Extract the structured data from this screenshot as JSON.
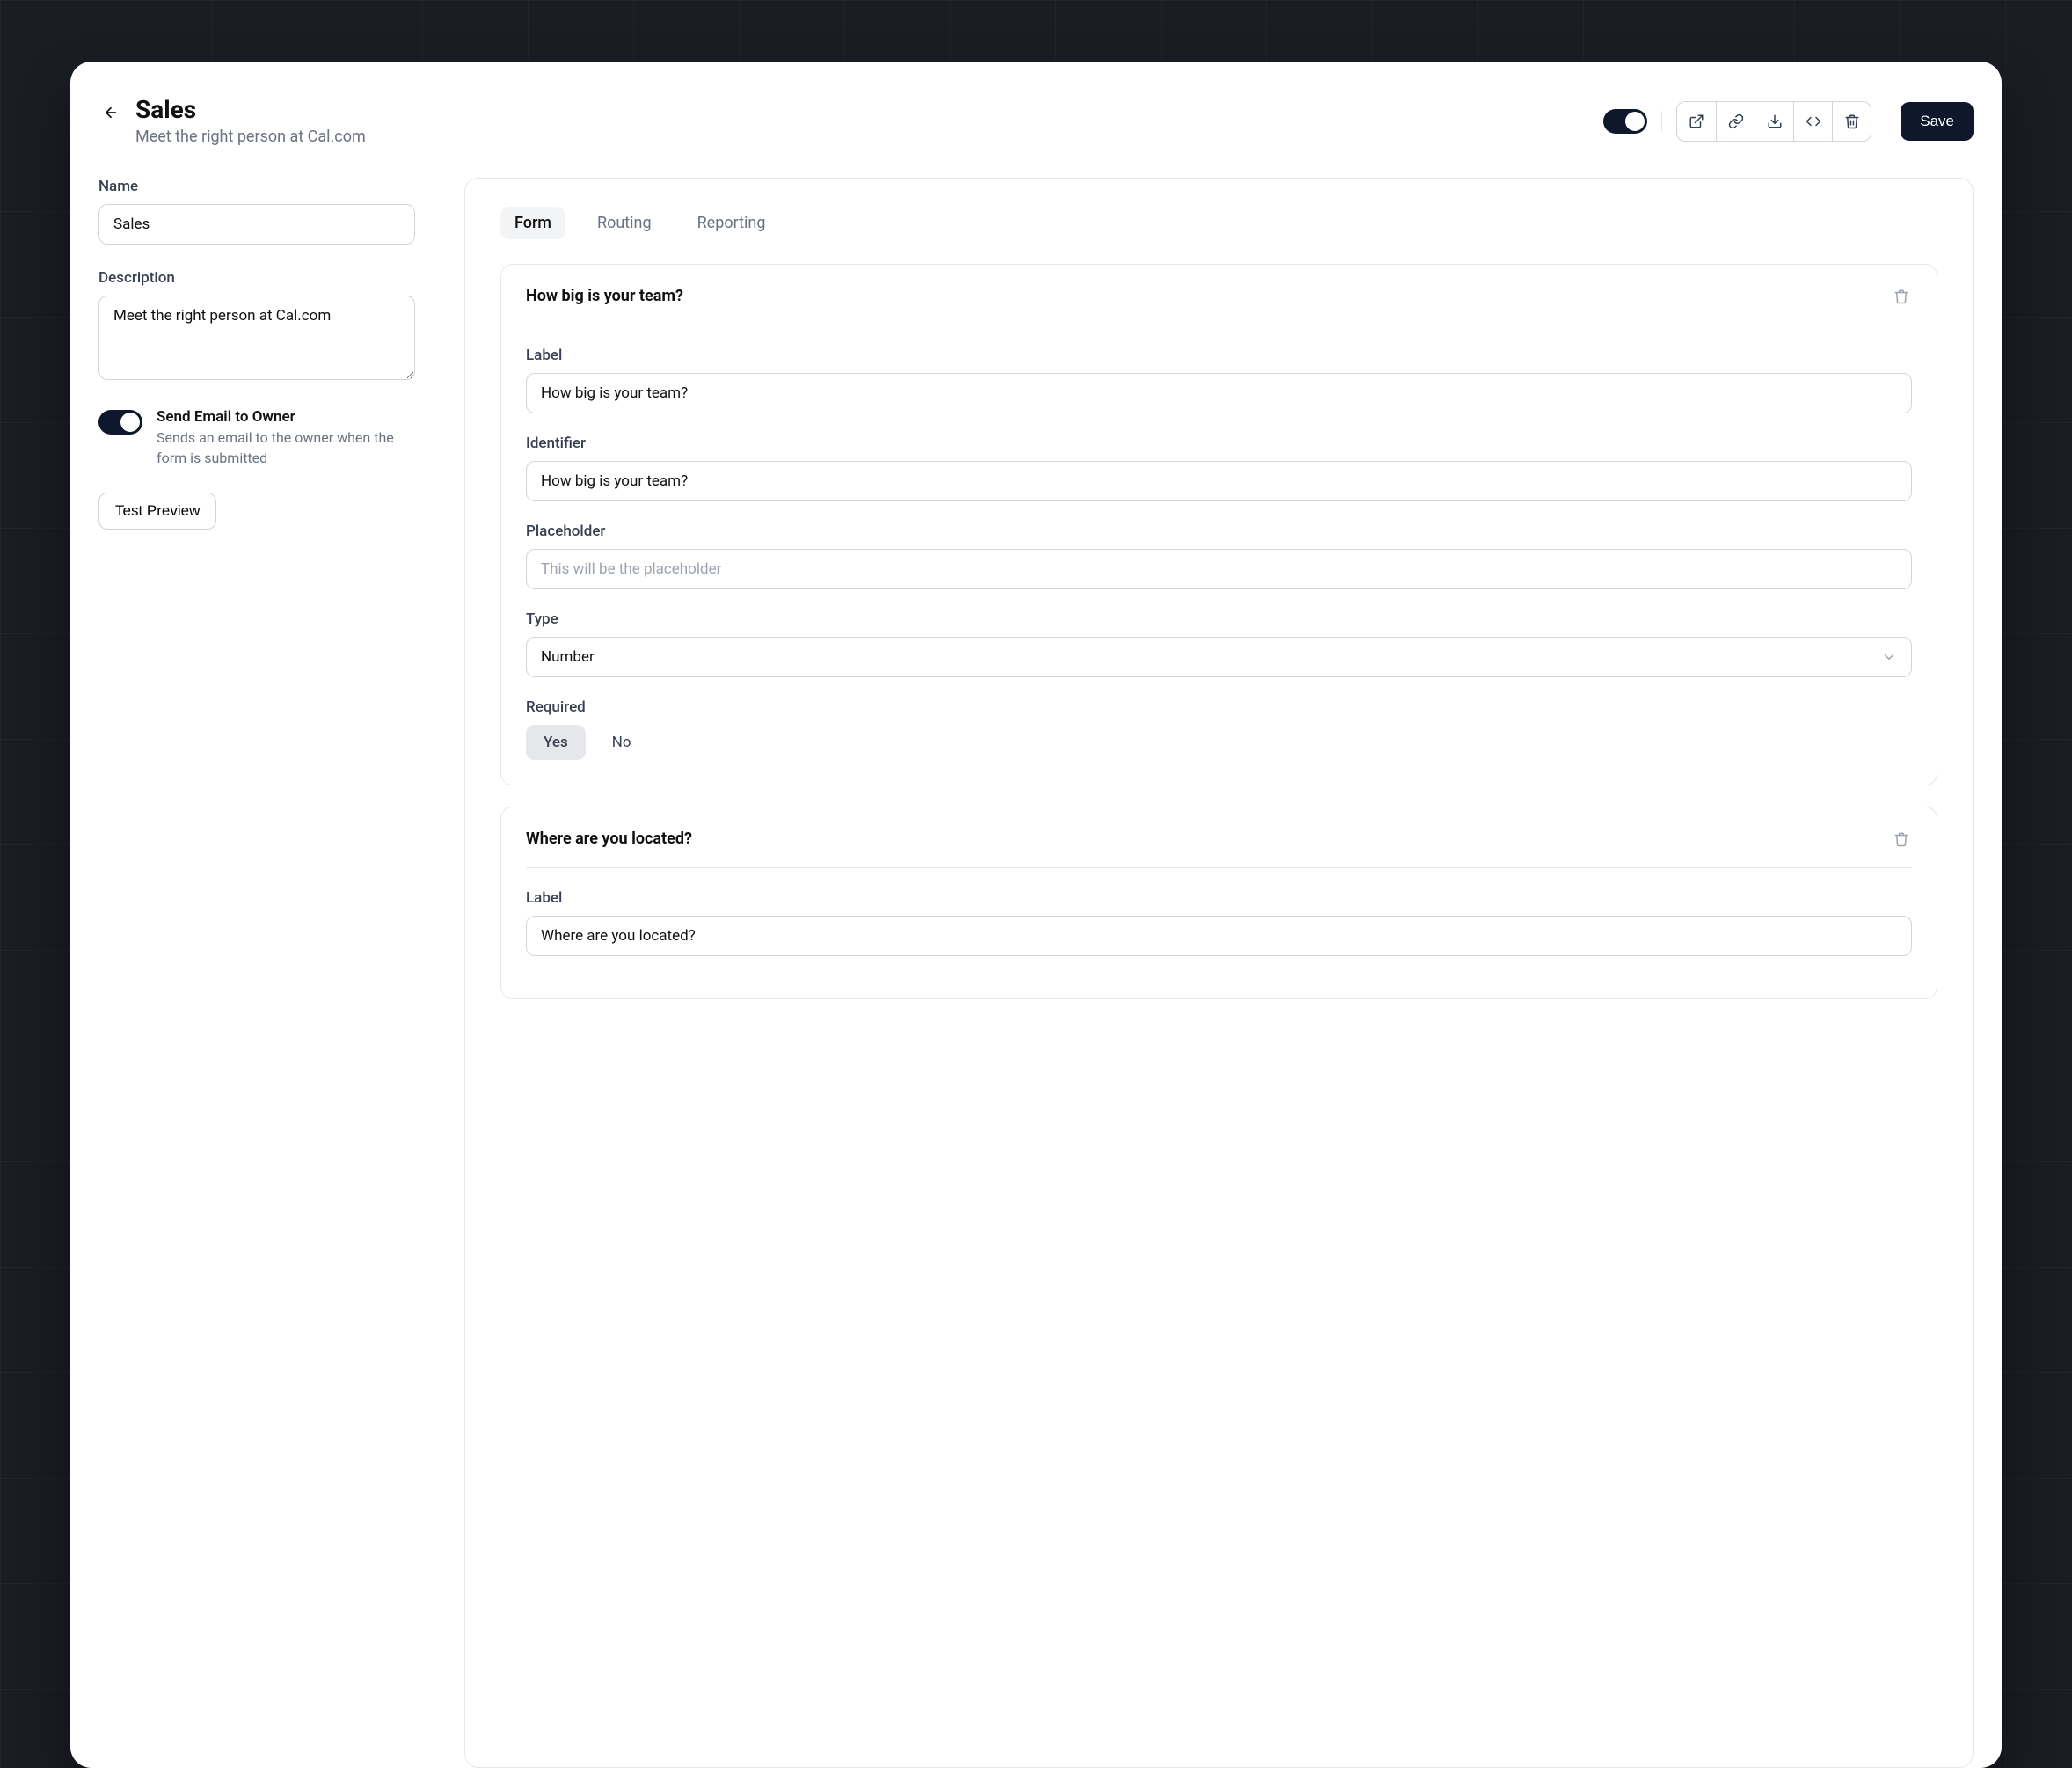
{
  "header": {
    "title": "Sales",
    "subtitle": "Meet the right person at Cal.com",
    "save_label": "Save"
  },
  "sidebar": {
    "name_label": "Name",
    "name_value": "Sales",
    "description_label": "Description",
    "description_value": "Meet the right person at Cal.com",
    "email_switch_title": "Send Email to Owner",
    "email_switch_desc": "Sends an email to the owner when the form is submitted",
    "test_preview_label": "Test Preview"
  },
  "tabs": [
    "Form",
    "Routing",
    "Reporting"
  ],
  "form_field_labels": {
    "label": "Label",
    "identifier": "Identifier",
    "placeholder": "Placeholder",
    "placeholder_ph": "This will be the placeholder",
    "type": "Type",
    "required": "Required",
    "yes": "Yes",
    "no": "No"
  },
  "questions": [
    {
      "title": "How big is your team?",
      "label": "How big is your team?",
      "identifier": "How big is your team?",
      "placeholder": "",
      "type": "Number",
      "required": "Yes"
    },
    {
      "title": "Where are you located?",
      "label": "Where are you located?",
      "identifier": "",
      "placeholder": "",
      "type": "",
      "required": ""
    }
  ]
}
